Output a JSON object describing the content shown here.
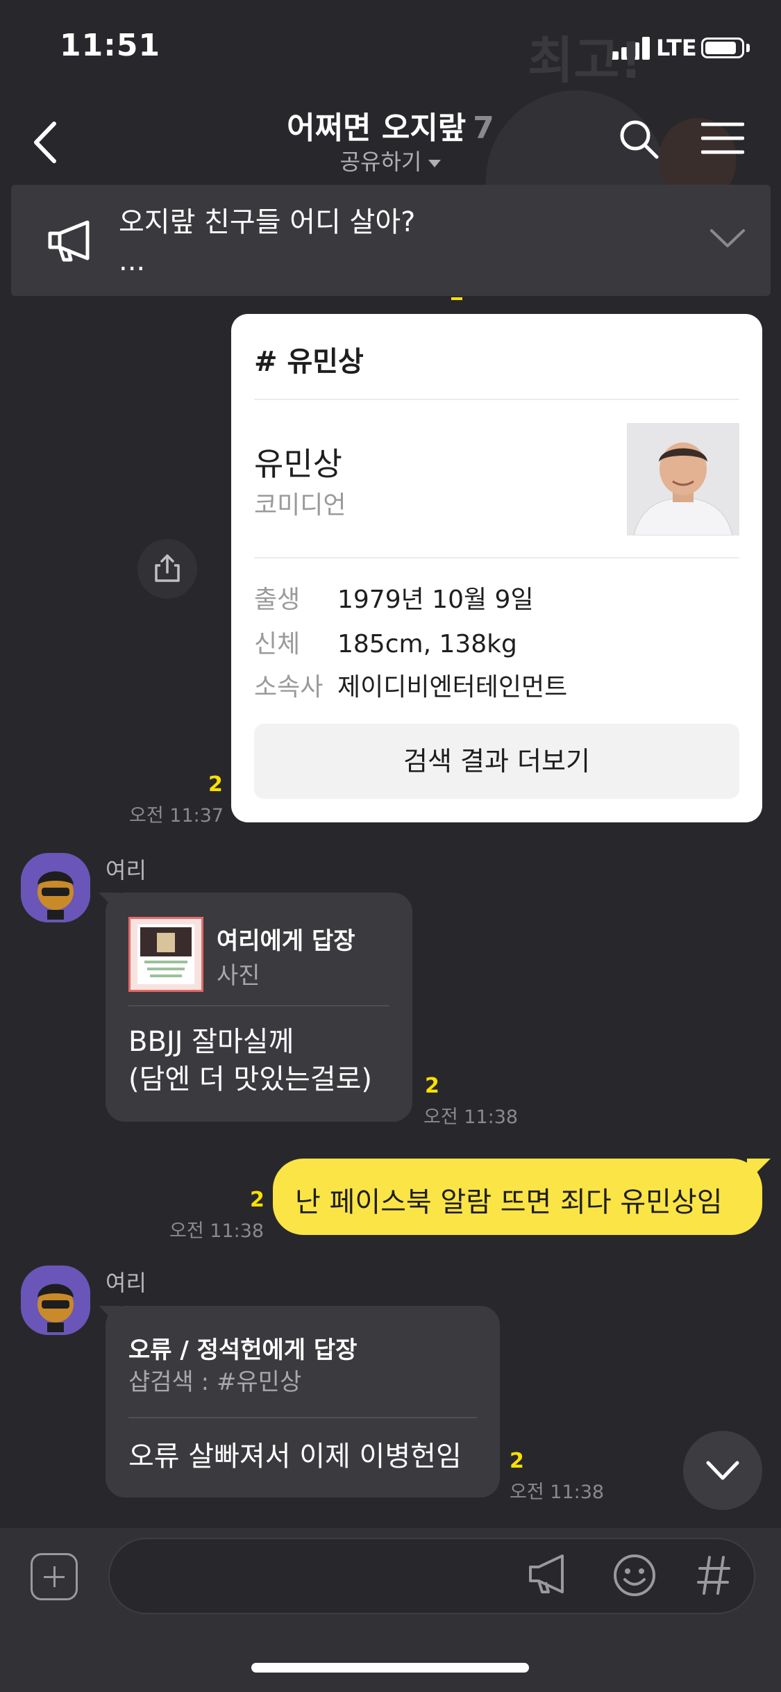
{
  "status": {
    "time": "11:51",
    "network": "LTE"
  },
  "watermark": {
    "text": "최고!"
  },
  "header": {
    "title": "어쩌면 오지랖",
    "member_count": "7",
    "share_label": "공유하기"
  },
  "notice": {
    "line1": "오지랖 친구들 어디 살아?",
    "line2": "..."
  },
  "profile_card": {
    "title": "# 유민상",
    "name": "유민상",
    "occupation": "코미디언",
    "info": [
      {
        "key": "출생",
        "value": "1979년 10월 9일"
      },
      {
        "key": "신체",
        "value": "185cm, 138kg"
      },
      {
        "key": "소속사",
        "value": "제이디비엔터테인먼트"
      }
    ],
    "more_button": "검색 결과 더보기",
    "unread": "2",
    "time": "오전 11:37"
  },
  "messages": [
    {
      "sender": "여리",
      "reply_title": "여리에게 답장",
      "reply_sub": "사진",
      "text_line1": "BBJJ 잘마실께",
      "text_line2": "(담엔 더 맛있는걸로)",
      "unread": "2",
      "time": "오전 11:38"
    },
    {
      "text": "난 페이스북 알람 뜨면 죄다 유민상임",
      "unread": "2",
      "time": "오전 11:38"
    },
    {
      "sender": "여리",
      "reply_title": "오류 / 정석헌에게 답장",
      "reply_sub": "샵검색 : #유민상",
      "text": "오류 살빠져서 이제 이병헌임",
      "unread": "2",
      "time": "오전 11:38"
    }
  ],
  "input": {
    "placeholder": ""
  },
  "colors": {
    "accent_yellow": "#fbe446",
    "unread_yellow": "#f9e000",
    "background": "#28282c"
  }
}
